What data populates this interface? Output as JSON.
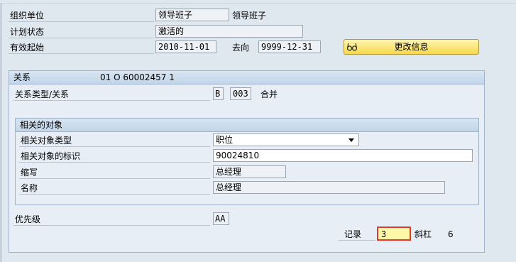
{
  "header": {
    "org_unit_label": "组织单位",
    "org_unit_value": "领导班子",
    "org_unit_text": "领导班子",
    "plan_status_label": "计划状态",
    "plan_status_value": "激活的",
    "valid_from_label": "有效起始",
    "valid_from_value": "2010-11-01",
    "valid_to_label": "去向",
    "valid_to_value": "9999-12-31",
    "change_info_button": "更改信息"
  },
  "relationship": {
    "title": "关系",
    "title_info": "01 O  60002457 1",
    "type_label": "关系类型/关系",
    "type_code": "B",
    "rel_code": "003",
    "rel_text": "合并"
  },
  "related_object": {
    "title": "相关的对象",
    "type_label": "相关对象类型",
    "type_value": "职位",
    "id_label": "相关对象的标识",
    "id_value": "90024810",
    "abbr_label": "缩写",
    "abbr_value": "总经理",
    "name_label": "名称",
    "name_value": "总经理"
  },
  "priority": {
    "label": "优先级",
    "value": "AA"
  },
  "record": {
    "label": "记录",
    "value": "3",
    "slash_label": "斜杠",
    "total": "6"
  },
  "icons": {
    "change_info": "glasses-icon",
    "dropdown": "chevron-down-icon"
  },
  "colors": {
    "button_bg": "#f7d94a",
    "group_header": "#c2d5e8",
    "record_field": "#fff8a8",
    "cursor_marker": "#e03a2c"
  }
}
